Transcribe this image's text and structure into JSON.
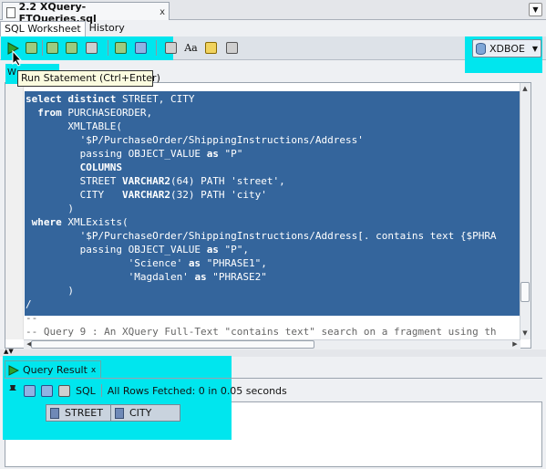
{
  "document_tab": {
    "title": "2.2 XQuery-FTQueries.sql",
    "close": "x"
  },
  "subtabs": [
    {
      "label": "SQL Worksheet",
      "active": true
    },
    {
      "label": "History",
      "active": false
    }
  ],
  "toolbar": {
    "buttons": [
      "run-statement-icon",
      "run-script-icon",
      "commit-icon",
      "rollback-icon",
      "explain-plan-icon",
      "autotrace-icon",
      "sql-tuning-icon",
      "clear-icon",
      "to-upper-lower-icon",
      "eraser-icon",
      "history-icon"
    ],
    "connection": "XDBOE"
  },
  "tooltip": {
    "text": "Run Statement (Ctrl+Enter)",
    "partial_label": "W"
  },
  "editor": {
    "lines": [
      "select distinct STREET, CITY",
      "  from PURCHASEORDER,",
      "       XMLTABLE(",
      "         '$P/PurchaseOrder/ShippingInstructions/Address'",
      "         passing OBJECT_VALUE as \"P\"",
      "         COLUMNS",
      "         STREET VARCHAR2(64) PATH 'street',",
      "         CITY   VARCHAR2(32) PATH 'city'",
      "       )",
      " where XMLExists(",
      "         '$P/PurchaseOrder/ShippingInstructions/Address[. contains text {$PHRA",
      "         passing OBJECT_VALUE as \"P\",",
      "                 'Science' as \"PHRASE1\",",
      "                 'Magdalen' as \"PHRASE2\"",
      "       )",
      "/",
      "--",
      "-- Query 9 : An XQuery Full-Text \"contains text\" search on a fragment using th"
    ],
    "selected_line_count": 16
  },
  "result_panel": {
    "tab_label": "Query Result",
    "tab_close": "x",
    "sql_label": "SQL",
    "status": "All Rows Fetched: 0 in 0.05 seconds",
    "columns": [
      "STREET",
      "CITY"
    ]
  },
  "colors": {
    "highlight": "#00e6ee",
    "selection": "#34659c"
  }
}
